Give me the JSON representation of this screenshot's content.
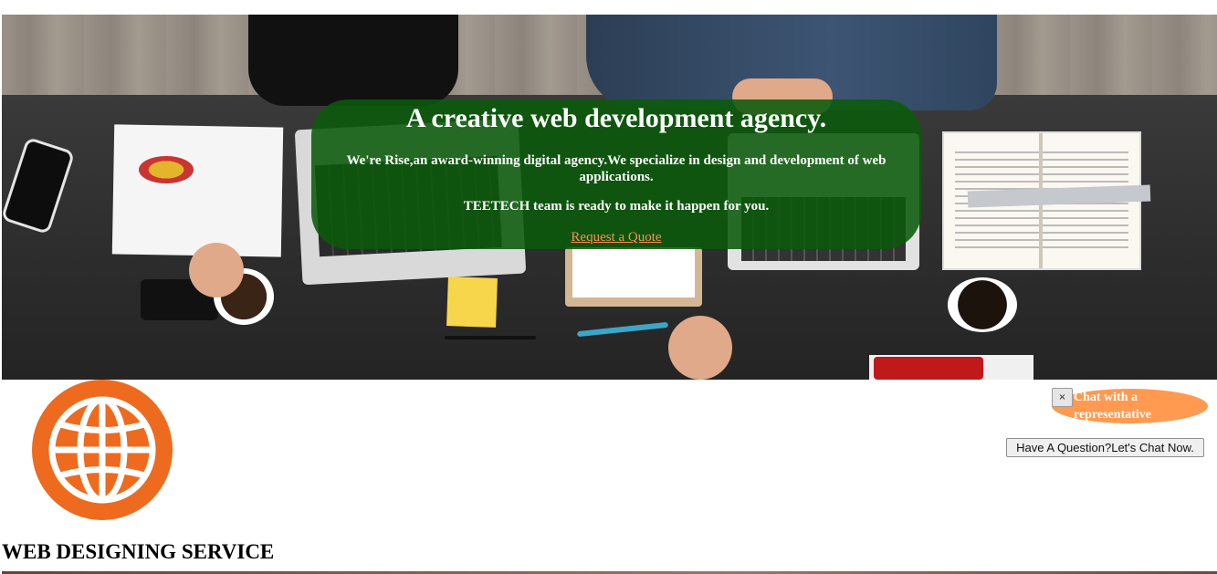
{
  "hero": {
    "headline": "A creative web development agency.",
    "description": "We're Rise,an award-winning digital agency.We specialize in design and development of web applications.",
    "team_line": "TEETECH team is ready to make it happen for you.",
    "cta_link": "Request a Quote"
  },
  "service": {
    "icon": "globe-icon",
    "title": "WEB DESIGNING SERVICE"
  },
  "chat": {
    "close_label": "×",
    "bubble_text": "Chat with a representative",
    "button_label": "Have A Question?Let's Chat Now."
  },
  "colors": {
    "overlay_green": "#0a5a0a",
    "link_orange": "#ff8c55",
    "globe_orange": "#ee6a1e",
    "chat_orange": "#ff9a50"
  }
}
